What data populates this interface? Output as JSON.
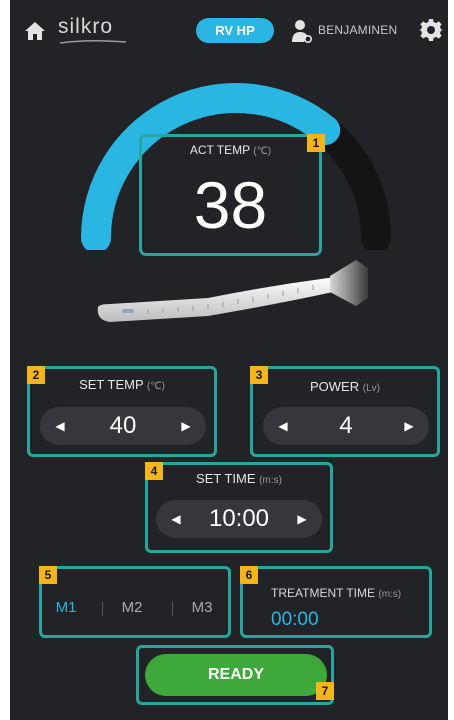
{
  "header": {
    "logo": "silkro",
    "mode": "RV HP",
    "user": "BENJAMINEN",
    "icons": {
      "home": "home-icon",
      "user": "user-icon",
      "settings": "gear-icon"
    }
  },
  "act_temp": {
    "label": "ACT TEMP",
    "unit": "(℃)",
    "value": "38",
    "badge": "1",
    "gauge_fraction": 0.72
  },
  "set_temp": {
    "label": "SET TEMP",
    "unit": "(℃)",
    "value": "40",
    "badge": "2"
  },
  "power": {
    "label": "POWER",
    "unit": "(Lv)",
    "value": "4",
    "badge": "3"
  },
  "set_time": {
    "label": "SET TIME",
    "unit": "(m:s)",
    "value": "10:00",
    "badge": "4"
  },
  "modes": {
    "items": [
      "M1",
      "M2",
      "M3"
    ],
    "active": "M1",
    "badge": "5"
  },
  "treatment_time": {
    "label": "TREATMENT TIME",
    "unit": "(m:s)",
    "value": "00:00",
    "badge": "6"
  },
  "ready": {
    "label": "READY",
    "badge": "7"
  },
  "stepper_arrows": {
    "left": "◀",
    "right": "▶"
  },
  "colors": {
    "accent": "#29b6e3",
    "panel_border": "#27a6a0",
    "badge": "#f3b51b",
    "ready": "#3ea93a",
    "background": "#222326"
  }
}
